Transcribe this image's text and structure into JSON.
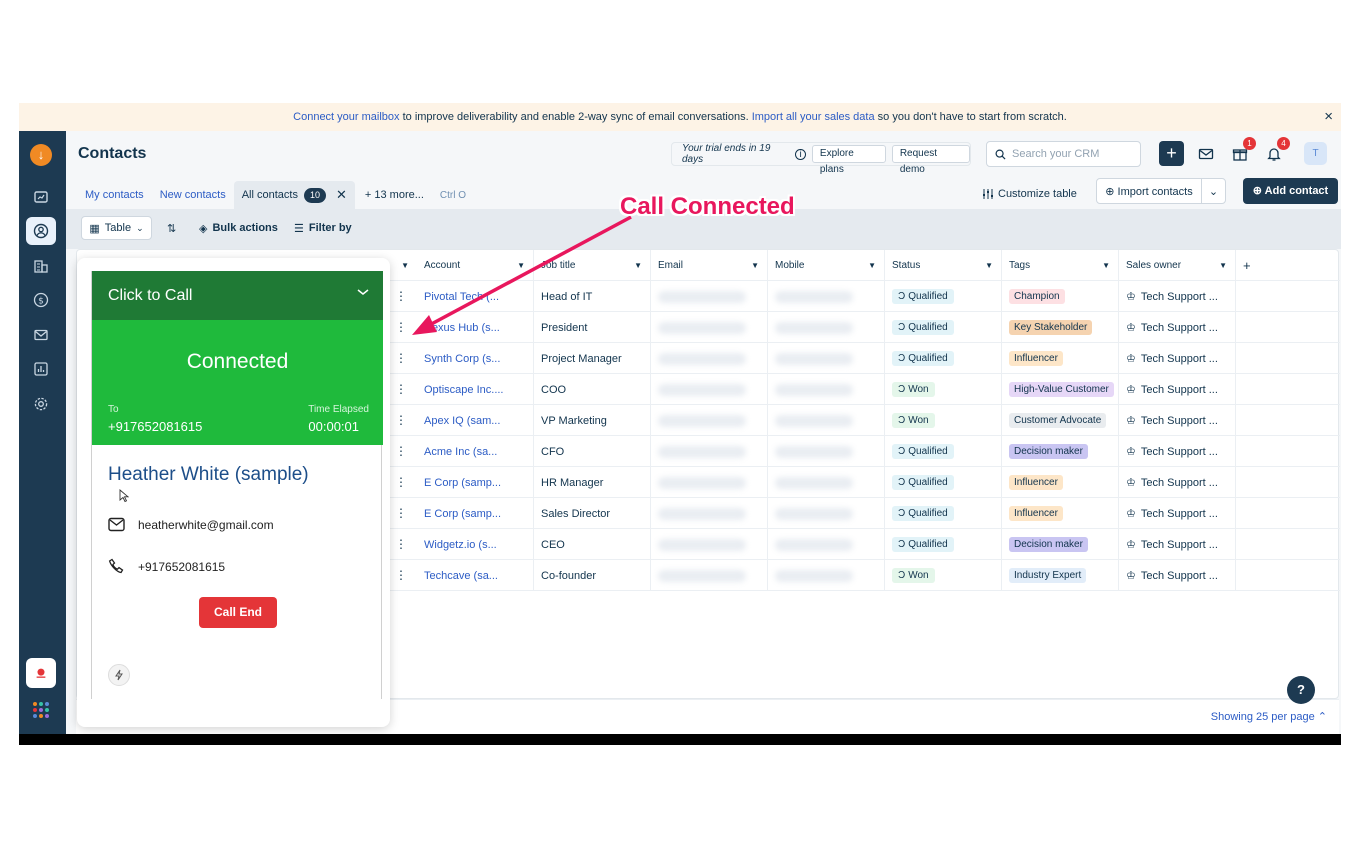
{
  "banner": {
    "link1": "Connect your mailbox",
    "text1": " to improve deliverability and enable 2-way sync of email conversations. ",
    "link2": "Import all your sales data",
    "text2": " so you don't have to start from scratch.",
    "close": "×"
  },
  "header": {
    "title": "Contacts",
    "trial_text": "Your trial ends in 19 days",
    "explore_plans": "Explore plans",
    "request_demo": "Request demo",
    "search_placeholder": "Search your CRM",
    "plus": "+",
    "gift_badge": "1",
    "bell_badge": "4",
    "avatar": "T"
  },
  "tabs": {
    "my_contacts": "My contacts",
    "new_contacts": "New contacts",
    "all_contacts": "All contacts",
    "all_count": "10",
    "more": "+ 13 more...",
    "shortcut": "Ctrl O",
    "customize_table": "Customize table",
    "import_contacts": "Import contacts",
    "add_contact": "Add contact"
  },
  "toolbar": {
    "view": "Table",
    "bulk_actions": "Bulk actions",
    "filter_by": "Filter by"
  },
  "table": {
    "columns": [
      "Account",
      "Job title",
      "Email",
      "Mobile",
      "Status",
      "Tags",
      "Sales owner"
    ],
    "add_column": "+",
    "rows": [
      {
        "account": "Pivotal Tech (...",
        "job": "Head of IT",
        "status": "Qualified",
        "tag": "Champion",
        "owner": "Tech Support ..."
      },
      {
        "account": "Nexus Hub (s...",
        "job": "President",
        "status": "Qualified",
        "tag": "Key Stakeholder",
        "owner": "Tech Support ..."
      },
      {
        "account": "Synth Corp (s...",
        "job": "Project Manager",
        "status": "Qualified",
        "tag": "Influencer",
        "owner": "Tech Support ..."
      },
      {
        "account": "Optiscape Inc....",
        "job": "COO",
        "status": "Won",
        "tag": "High-Value Customer",
        "owner": "Tech Support ..."
      },
      {
        "account": "Apex IQ (sam...",
        "job": "VP Marketing",
        "status": "Won",
        "tag": "Customer Advocate",
        "owner": "Tech Support ..."
      },
      {
        "account": "Acme Inc (sa...",
        "job": "CFO",
        "status": "Qualified",
        "tag": "Decision maker",
        "owner": "Tech Support ..."
      },
      {
        "account": "E Corp (samp...",
        "job": "HR Manager",
        "status": "Qualified",
        "tag": "Influencer",
        "owner": "Tech Support ..."
      },
      {
        "account": "E Corp (samp...",
        "job": "Sales Director",
        "status": "Qualified",
        "tag": "Influencer",
        "owner": "Tech Support ..."
      },
      {
        "account": "Widgetz.io (s...",
        "job": "CEO",
        "status": "Qualified",
        "tag": "Decision maker",
        "owner": "Tech Support ..."
      },
      {
        "account": "Techcave (sa...",
        "job": "Co-founder",
        "status": "Won",
        "tag": "Industry Expert",
        "owner": "Tech Support ..."
      }
    ],
    "tag_colors": {
      "Champion": "#fde0e3",
      "Key Stakeholder": "#f5d3b0",
      "Influencer": "#fde6c8",
      "High-Value Customer": "#e6d7f7",
      "Customer Advocate": "#e9ecef",
      "Decision maker": "#c9c5f2",
      "Industry Expert": "#e2edf9"
    },
    "per_page": "Showing 25 per page"
  },
  "call_panel": {
    "title": "Click to Call",
    "status": "Connected",
    "to_label": "To",
    "to_number": "+917652081615",
    "elapsed_label": "Time Elapsed",
    "elapsed": "00:00:01",
    "contact_name": "Heather White (sample)",
    "email": "heatherwhite@gmail.com",
    "phone": "+917652081615",
    "end_button": "Call End"
  },
  "annotation": {
    "label": "Call Connected",
    "color": "#e8175d"
  },
  "help": "?"
}
